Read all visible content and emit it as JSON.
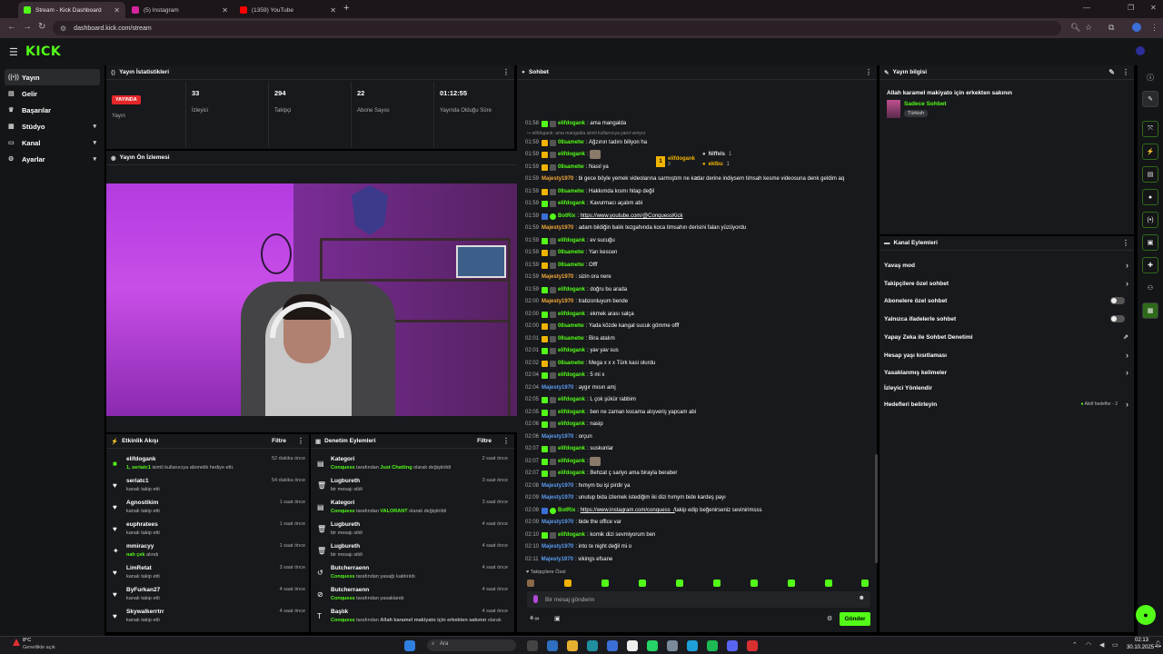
{
  "browser": {
    "tabs": [
      {
        "title": "Stream - Kick Dashboard",
        "color": "#53fc18"
      },
      {
        "title": "(5) Instagram",
        "color": "#d6249f"
      },
      {
        "title": "(1359) YouTube",
        "color": "#ff0000"
      }
    ],
    "url": "dashboard.kick.com/stream"
  },
  "brand": {
    "logo": "KICK"
  },
  "nav": {
    "items": [
      {
        "label": "Yayın",
        "icon": "broadcast-icon"
      },
      {
        "label": "Gelir",
        "icon": "wallet-icon"
      },
      {
        "label": "Başarılar",
        "icon": "trophy-icon"
      },
      {
        "label": "Stüdyo",
        "icon": "studio-icon"
      },
      {
        "label": "Kanal",
        "icon": "channel-icon"
      },
      {
        "label": "Ayarlar",
        "icon": "settings-icon"
      }
    ]
  },
  "stats": {
    "title": "Yayın İstatistikleri",
    "live_badge": "YAYINDA",
    "live_label": "Yayın",
    "viewers": {
      "value": "33",
      "label": "İzleyici"
    },
    "followers": {
      "value": "294",
      "label": "Takipçi"
    },
    "subs": {
      "value": "22",
      "label": "Abone Sayısı"
    },
    "duration": {
      "value": "01:12:55",
      "label": "Yayında Olduğu Süre"
    }
  },
  "preview": {
    "title": "Yayın Ön İzlemesi"
  },
  "activity": {
    "title": "Etkinlik Akışı",
    "filter": "Filtre",
    "items": [
      {
        "name": "elifdogank",
        "sub_green": "1, seriatc1",
        "sub": " isimli kullanıcıya abonelik hediye etti.",
        "time": "52 dakika önce",
        "icon": "gift-icon"
      },
      {
        "name": "seriatc1",
        "sub": "kanalı takip etti",
        "time": "54 dakika önce",
        "icon": "heart-icon"
      },
      {
        "name": "Agnostikim",
        "sub": "kanalı takip etti",
        "time": "1 saat önce",
        "icon": "heart-icon"
      },
      {
        "name": "euphratees",
        "sub": "kanalı takip etti",
        "time": "1 saat önce",
        "icon": "heart-icon"
      },
      {
        "name": "mmiracyy",
        "sub_green": "nah çek",
        "sub": " alındı",
        "time": "1 saat önce",
        "icon": "reward-icon"
      },
      {
        "name": "LimRetat",
        "sub": "kanalı takip etti",
        "time": "3 saat önce",
        "icon": "heart-icon"
      },
      {
        "name": "ByFurkan27",
        "sub": "kanalı takip etti",
        "time": "4 saat önce",
        "icon": "heart-icon"
      },
      {
        "name": "Skywalkerrtrr",
        "sub": "kanalı takip etti",
        "time": "4 saat önce",
        "icon": "heart-icon"
      }
    ]
  },
  "moderation": {
    "title": "Denetim Eylemleri",
    "filter": "Filtre",
    "items": [
      {
        "name": "Kategori",
        "sub_green": "Conquess",
        "sub": " tarafından ",
        "sub_green2": "Just Chatting",
        "sub2": " olarak değiştirildi",
        "time": "2 saat önce",
        "icon": "category-icon"
      },
      {
        "name": "Lugbureth",
        "sub": "bir mesajı sildi",
        "time": "3 saat önce",
        "icon": "trash-icon"
      },
      {
        "name": "Kategori",
        "sub_green": "Conquess",
        "sub": " tarafından ",
        "sub_green2": "VALORANT",
        "sub2": " olarak değiştirildi",
        "time": "3 saat önce",
        "icon": "category-icon"
      },
      {
        "name": "Lugbureth",
        "sub": "bir mesajı sildi",
        "time": "4 saat önce",
        "icon": "trash-icon"
      },
      {
        "name": "Lugbureth",
        "sub": "bir mesajı sildi",
        "time": "4 saat önce",
        "icon": "trash-icon"
      },
      {
        "name": "Butcherraenn",
        "sub_green": "Conquess",
        "sub": " tarafından yasağı kaldırıldı",
        "time": "4 saat önce",
        "icon": "unban-icon"
      },
      {
        "name": "Butcherraenn",
        "sub_green": "Conquess",
        "sub": " tarafından yasaklandı",
        "time": "4 saat önce",
        "icon": "ban-icon"
      },
      {
        "name": "Başlık",
        "sub_green": "Conquess",
        "sub": " tarafından ",
        "sub_bold": "Allah karamel makiyato için erkekten sakının",
        "sub2": " olarak",
        "time": "4 saat önce",
        "icon": "title-icon"
      }
    ]
  },
  "chat": {
    "title": "Sohbet",
    "pinned": [
      {
        "rank": "1",
        "name": "elifdogank",
        "count": "3"
      },
      {
        "rank": "",
        "name": "Niffels",
        "count": "1"
      },
      {
        "rank": "",
        "name": "ektbu",
        "count": "1"
      }
    ],
    "reply_note": "elifdogank: ama mangalda isimli kullanıcıya yanıt veriyor",
    "messages": [
      {
        "t": "01:58",
        "u": "elifdogank",
        "c": "#53fc18",
        "m": "ama mangalda"
      },
      {
        "t": "01:59",
        "u": "08sametw",
        "c": "#53fc18",
        "m": "Ağzının tadını biliyon ha"
      },
      {
        "t": "01:59",
        "u": "elifdogank",
        "c": "#53fc18",
        "m": "",
        "emote": true
      },
      {
        "t": "01:59",
        "u": "08sametw",
        "c": "#53fc18",
        "m": "Nasıl ya"
      },
      {
        "t": "01:59",
        "u": "Majesty1970",
        "c": "#f2a93b",
        "m": "bi gece böyle yemek videolarına sarmıştım ne kadar derine indiysem timsah kesme videosuna denk geldim aq",
        "nobadge": true
      },
      {
        "t": "01:59",
        "u": "08sametw",
        "c": "#53fc18",
        "m": "Hakkımda kısmı hitap değil"
      },
      {
        "t": "01:59",
        "u": "elifdogank",
        "c": "#53fc18",
        "m": "Kavurmacı açalım abi"
      },
      {
        "t": "01:59",
        "u": "BotRix",
        "c": "#53fc18",
        "m": "https://www.youtube.com/@ConquessKick",
        "link": true
      },
      {
        "t": "01:59",
        "u": "Majesty1970",
        "c": "#f2a93b",
        "m": "adam bildiğin balık tezgahında koca timsahın derisini falan yüzüyordu",
        "nobadge": true
      },
      {
        "t": "01:59",
        "u": "elifdogank",
        "c": "#53fc18",
        "m": "ev sucuğu"
      },
      {
        "t": "01:59",
        "u": "08sametw",
        "c": "#53fc18",
        "m": "Yarı kescen"
      },
      {
        "t": "01:59",
        "u": "08sametw",
        "c": "#53fc18",
        "m": "Offf"
      },
      {
        "t": "01:59",
        "u": "Majesty1970",
        "c": "#f2a93b",
        "m": "sizin ora nere",
        "nobadge": true
      },
      {
        "t": "01:59",
        "u": "elifdogank",
        "c": "#53fc18",
        "m": "doğru bu arada"
      },
      {
        "t": "02:00",
        "u": "Majesty1970",
        "c": "#f2a93b",
        "m": "trabzonluyum bende",
        "nobadge": true
      },
      {
        "t": "02:00",
        "u": "elifdogank",
        "c": "#53fc18",
        "m": "ekmek arası salça"
      },
      {
        "t": "02:00",
        "u": "08sametw",
        "c": "#53fc18",
        "m": "Yada közde kangal sucuk gömme offf"
      },
      {
        "t": "02:01",
        "u": "08sametw",
        "c": "#53fc18",
        "m": "Bira atalım"
      },
      {
        "t": "02:01",
        "u": "elifdogank",
        "c": "#53fc18",
        "m": "yav yav sus"
      },
      {
        "t": "02:02",
        "u": "08sametw",
        "c": "#53fc18",
        "m": "Mega x x x Türk kasi olurdu"
      },
      {
        "t": "02:04",
        "u": "elifdogank",
        "c": "#53fc18",
        "m": "5 mi x"
      },
      {
        "t": "02:04",
        "u": "Majesty1970",
        "c": "#5b9cf2",
        "m": "aygır mısın amj",
        "nobadge": true
      },
      {
        "t": "02:05",
        "u": "elifdogank",
        "c": "#53fc18",
        "m": "L çok şükür rabbim"
      },
      {
        "t": "02:05",
        "u": "elifdogank",
        "c": "#53fc18",
        "m": "ben ne zaman kocama alışveriş yapcam abi"
      },
      {
        "t": "02:06",
        "u": "elifdogank",
        "c": "#53fc18",
        "m": "nasip"
      },
      {
        "t": "02:06",
        "u": "Majesty1970",
        "c": "#5b9cf2",
        "m": "orçun",
        "nobadge": true
      },
      {
        "t": "02:07",
        "u": "elifdogank",
        "c": "#53fc18",
        "m": "suskunlar"
      },
      {
        "t": "02:07",
        "u": "elifdogank",
        "c": "#53fc18",
        "m": "",
        "emote": true
      },
      {
        "t": "02:07",
        "u": "elifdogank",
        "c": "#53fc18",
        "m": "Behzat ç sariyo ama birayla beraber"
      },
      {
        "t": "02:08",
        "u": "Majesty1970",
        "c": "#5b9cf2",
        "m": "hımym bu işi pirdir ya",
        "nobadge": true
      },
      {
        "t": "02:09",
        "u": "Majesty1970",
        "c": "#5b9cf2",
        "m": "unutup bida izlemek istediğim iki dizi hımym bide kardeş payı",
        "nobadge": true
      },
      {
        "t": "02:09",
        "u": "BotRix",
        "c": "#53fc18",
        "m": "https://www.instagram.com/conquess_/",
        "m2": " takip edip beğenirseniz sevinirimsss",
        "link": true
      },
      {
        "t": "02:09",
        "u": "Majesty1970",
        "c": "#5b9cf2",
        "m": "bide the office var",
        "nobadge": true
      },
      {
        "t": "02:10",
        "u": "elifdogank",
        "c": "#53fc18",
        "m": "komik dizi sevmiyorum ben"
      },
      {
        "t": "02:10",
        "u": "Majesty1970",
        "c": "#5b9cf2",
        "m": "into te night değil mi o",
        "nobadge": true
      },
      {
        "t": "02:11",
        "u": "Majesty1970",
        "c": "#5b9cf2",
        "m": "vikings efsane",
        "nobadge": true
      }
    ],
    "followers_only": "Takipçilere Özel",
    "input_placeholder": "Bir mesaj gönderin",
    "send": "Gönder"
  },
  "stream_info": {
    "title": "Yayın bilgisi",
    "stream_title": "Allah karamel makiyato için erkekten sakının",
    "category": "Sadece Sohbet",
    "tag": "Türkish"
  },
  "channel_actions": {
    "title": "Kanal Eylemleri",
    "items": [
      {
        "label": "Yavaş mod",
        "type": "arrow"
      },
      {
        "label": "Takipçilere özel sohbet",
        "type": "arrow"
      },
      {
        "label": "Abonelere özel sohbet",
        "type": "toggle"
      },
      {
        "label": "Yalnızca ifadelerle sohbet",
        "type": "toggle"
      },
      {
        "label": "Yapay Zeka ile Sohbet Denetimi",
        "type": "ext"
      },
      {
        "label": "Hesap yaşı kısıtlaması",
        "type": "arrow"
      },
      {
        "label": "Yasaklanmış kelimeler",
        "type": "arrow"
      },
      {
        "label": "İzleyici Yönlendir",
        "type": "none"
      },
      {
        "label": "Hedefleri belirleyin",
        "type": "goal",
        "extra": "Aktif hedefler - 2"
      }
    ]
  },
  "taskbar": {
    "weather_temp": "8°C",
    "weather_text": "Genellikle açık",
    "search": "Ara",
    "time": "02:13",
    "date": "30.10.2025"
  }
}
